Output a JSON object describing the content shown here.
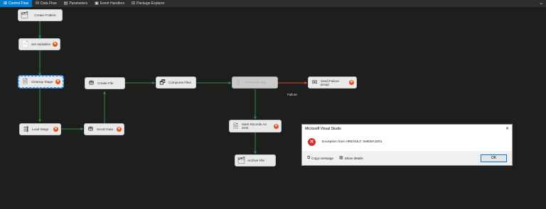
{
  "tabs": [
    {
      "label": "Control Flow",
      "icon": "control-flow-icon"
    },
    {
      "label": "Data Flow",
      "icon": "data-flow-icon"
    },
    {
      "label": "Parameters",
      "icon": "parameters-icon"
    },
    {
      "label": "Event Handlers",
      "icon": "event-handlers-icon"
    },
    {
      "label": "Package Explorer",
      "icon": "package-explorer-icon"
    }
  ],
  "tasks": {
    "create_folders": "Create Folders",
    "set_variables": "Set Variables",
    "cleanup_stage": "Cleanup Stage",
    "load_stage": "Load Stage",
    "scrub_data": "Scrub Data",
    "create_file": "Create File",
    "compress_files": "Compress Files",
    "ftp_push_task": "FTP Push Task",
    "send_failure_email": "Send Failure Email",
    "mark_records_as_sent": "Mark Records As Sent",
    "archive_file": "Archive File"
  },
  "links": {
    "failure_label": "Failure"
  },
  "colors": {
    "success_link": "#2e8b3e",
    "failure_link": "#d4502a",
    "active_tab": "#007acc",
    "error_badge": "#e2511f"
  },
  "dialog": {
    "title": "Microsoft Visual Studio",
    "message": "Exception from HRESULT: 0x800A1001",
    "copy_message": "Copy message",
    "show_details": "Show details",
    "ok": "OK"
  }
}
